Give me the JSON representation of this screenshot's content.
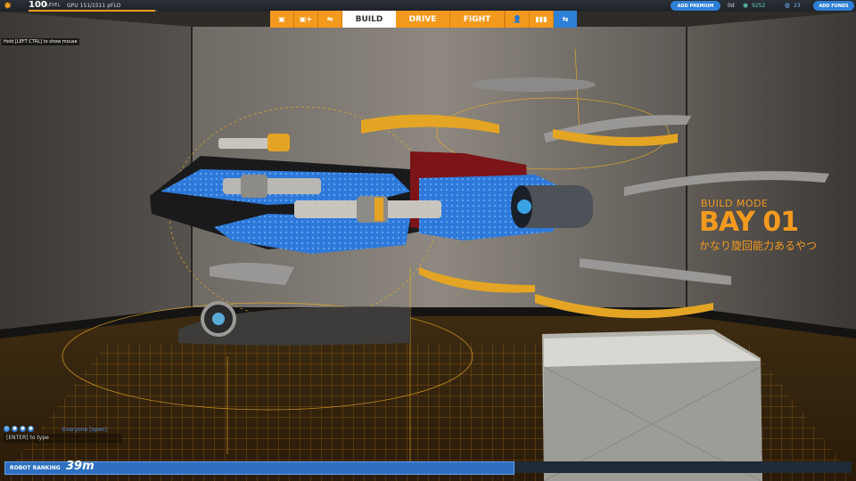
{
  "hud": {
    "level": "100",
    "level_label": "LEVEL",
    "gpu": "GPU 151/1511 pFLO",
    "hint": "Hold [LEFT CTRL] to show mouse",
    "xp_fraction": 0.98
  },
  "mode_tabs": [
    {
      "label": "▣",
      "icon": "cube-icon"
    },
    {
      "label": "▣+",
      "icon": "cube-plus-icon"
    },
    {
      "label": "⇋",
      "icon": "connect-icon"
    },
    {
      "label": "BUILD"
    },
    {
      "label": "DRIVE"
    },
    {
      "label": "FIGHT"
    },
    {
      "label": "👤",
      "icon": "user-icon"
    },
    {
      "label": "▮▮▮",
      "icon": "stats-icon"
    },
    {
      "label": "⇆",
      "icon": "tool-icon"
    }
  ],
  "account": {
    "premium_label": "ADD PREMIUM",
    "days": "0d",
    "robits": "9252",
    "cosmetic": "23",
    "funds_label": "ADD FUNDS"
  },
  "bay": {
    "mode": "BUILD MODE",
    "name": "BAY 01",
    "robot_name": "かなり旋回能力あるやつ"
  },
  "chat": {
    "channel": "Everyone [open]",
    "input_hint": "[ENTER] to type"
  },
  "ranking": {
    "label": "ROBOT RANKING",
    "value": "39m"
  },
  "colors": {
    "accent": "#f39a1e",
    "blue": "#2e7fd6"
  }
}
